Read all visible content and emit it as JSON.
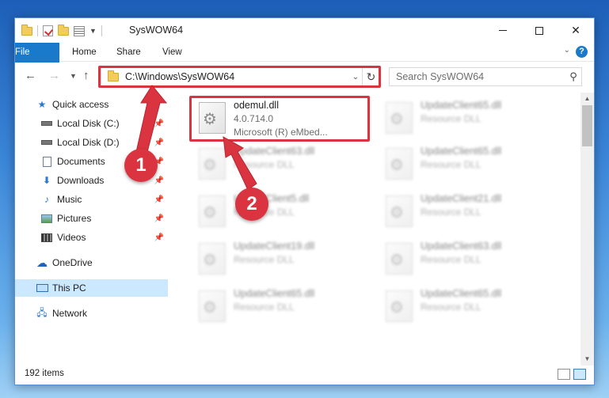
{
  "window": {
    "title": "SysWOW64",
    "controls": {
      "minimize": "",
      "maximize": "",
      "close": "✕"
    }
  },
  "ribbon": {
    "tabs": [
      "File",
      "Home",
      "Share",
      "View"
    ],
    "help": "?"
  },
  "address": {
    "path": "C:\\Windows\\SysWOW64",
    "search_placeholder": "Search SysWOW64"
  },
  "nav_pane": {
    "items": [
      {
        "label": "Quick access",
        "icon": "star-icon"
      },
      {
        "label": "Local Disk (C:)",
        "icon": "drive-icon",
        "pinned": true
      },
      {
        "label": "Local Disk (D:)",
        "icon": "drive-icon",
        "pinned": true
      },
      {
        "label": "Documents",
        "icon": "documents-icon",
        "pinned": true
      },
      {
        "label": "Downloads",
        "icon": "download-icon",
        "pinned": true
      },
      {
        "label": "Music",
        "icon": "music-icon",
        "pinned": true
      },
      {
        "label": "Pictures",
        "icon": "pictures-icon",
        "pinned": true
      },
      {
        "label": "Videos",
        "icon": "videos-icon",
        "pinned": true
      },
      {
        "label": "OneDrive",
        "icon": "cloud-icon"
      },
      {
        "label": "This PC",
        "icon": "computer-icon",
        "selected": true
      },
      {
        "label": "Network",
        "icon": "network-icon"
      }
    ]
  },
  "files": [
    {
      "name": "odemul.dll",
      "line2": "4.0.714.0",
      "line3": "Microsoft (R) eMbed..."
    },
    {
      "name": "UpdateClient65.dll",
      "line2": "Resource DLL"
    },
    {
      "name": "UpdateClient63.dll",
      "line2": "Resource DLL"
    },
    {
      "name": "UpdateClient65.dll",
      "line2": "Resource DLL"
    },
    {
      "name": "UpdateClient5.dll",
      "line2": "Resource DLL"
    },
    {
      "name": "UpdateClient21.dll",
      "line2": "Resource DLL"
    },
    {
      "name": "UpdateClient19.dll",
      "line2": "Resource DLL"
    },
    {
      "name": "UpdateClient63.dll",
      "line2": "Resource DLL"
    },
    {
      "name": "UpdateClient65.dll",
      "line2": "Resource DLL"
    },
    {
      "name": "UpdateClient65.dll",
      "line2": "Resource DLL"
    }
  ],
  "status": {
    "item_count": "192 items"
  },
  "annotations": {
    "step1": "1",
    "step2": "2",
    "color": "#d9343f"
  }
}
